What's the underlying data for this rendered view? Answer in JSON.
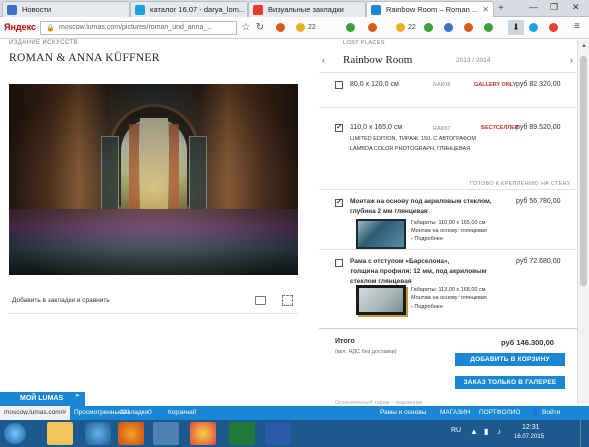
{
  "tabs": [
    {
      "label": "Новости",
      "color": "#3b71c8"
    },
    {
      "label": "каталог 16.07 - darya_lom...",
      "color": "#1ba0e2"
    },
    {
      "label": "Визуальные закладки",
      "color": "#e63b2e"
    },
    {
      "label": "Rainbow Room – Roman ...",
      "color": "#1a86d6",
      "active": true
    }
  ],
  "browser": {
    "brand": "Яндекс",
    "url": "moscow.lumas.com/pictures/roman_und_anna_...",
    "weather1": "22",
    "weather2": "22"
  },
  "left": {
    "subtitle": "ИЗДАНИЕ ИСКУССТВ",
    "artist": "ROMAN & ANNA KÜFFNER",
    "bookmark_link": "Добавить в закладки и сравнить"
  },
  "right": {
    "breadcrumb": "LOST PLACES",
    "title": "Rainbow Room",
    "year": "2013 / 2014",
    "options": [
      {
        "size": "80,0 x 120,0 см",
        "code": "RAK08",
        "badge": "GALLERY ONLY",
        "price": "руб 82.320,00",
        "checked": false
      },
      {
        "size": "110,0 x 165,0 см",
        "code": "RAK07",
        "badge": "БЕСТСЕЛЛЕР",
        "price": "руб 89.520,00",
        "checked": true,
        "desc1": "LIMITED EDITION, ТИРАЖ: 150, С АВТОГРАФОМ",
        "desc2": "LAMBDA COLOR PHOTOGRAPH, ГЛЯНЦЕВАЯ"
      }
    ],
    "ready_label": "ГОТОВО К КРЕПЛЕНИЮ НА СТЕНУ",
    "mounts": [
      {
        "title1": "Монтаж на основу под акриловым стеклом,",
        "title2": "глубина 2 мм глянцевая",
        "price": "руб 56.780,00",
        "dims": "Габариты: 110,00 x 165,00 см",
        "mount": "Монтаж на основу: глянцевая",
        "more": "Подробнее",
        "checked": true
      },
      {
        "title1": "Рама с отступом «Барселона»,",
        "title2": "толщина профиля: 12 мм, под акриловым",
        "title3": "стеклом глянцевая",
        "price": "руб 72.680,00",
        "dims": "Габариты: 113,00 x 168,00 см",
        "mount": "Монтаж на основу: глянцевая",
        "more": "Подробнее",
        "checked": false
      }
    ],
    "total_label": "Итого",
    "total_value": "руб 146.300,00",
    "tax_note": "(вкл. НДС без доставки)",
    "btn_cart": "ДОБАВИТЬ В КОРЗИНУ",
    "btn_gallery": "ЗАКАЗ ТОЛЬКО В ГАЛЕРЕЕ",
    "fade_text": "Ограниченный тираж – подлинник",
    "footer_links": [
      "Рамы и основы",
      "МАГАЗИН",
      "ПОРТФОЛИО",
      "Войти"
    ]
  },
  "bottom": {
    "mylumas": "МОЙ LUMAS",
    "status_url": "moscow.lumas.com/#",
    "status_items": [
      "Просмотренные21",
      "Закладки0",
      "Корзина0"
    ]
  },
  "taskbar": {
    "lang": "RU",
    "time": "12:31",
    "date": "16.07.2015"
  }
}
